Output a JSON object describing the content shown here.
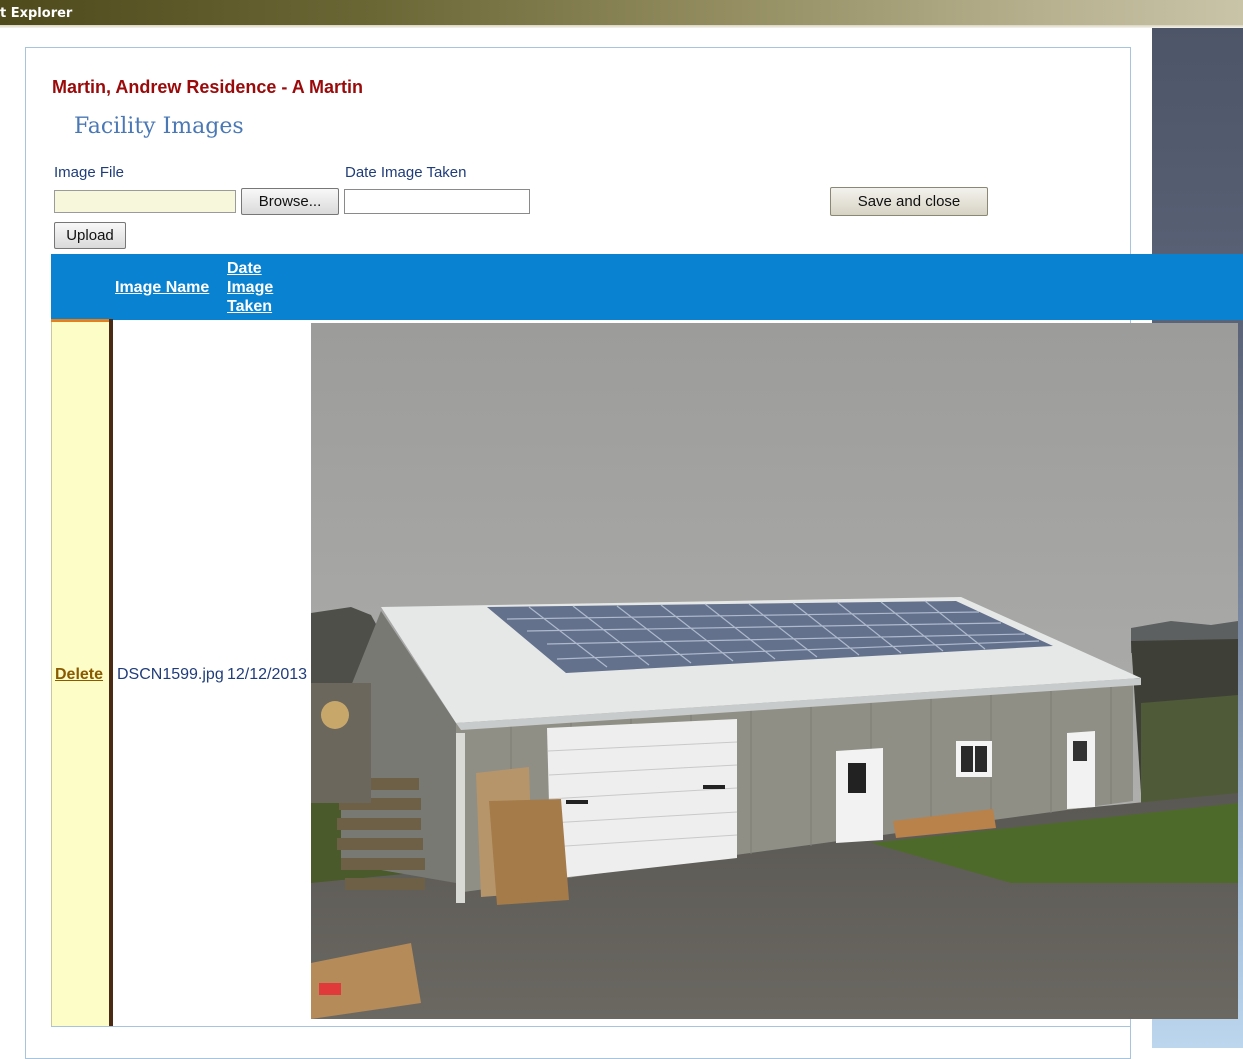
{
  "window": {
    "title": "t Explorer"
  },
  "facility": {
    "name": "Martin, Andrew Residence - A Martin"
  },
  "section": {
    "title": "Facility Images"
  },
  "form": {
    "image_file_label": "Image File",
    "date_taken_label": "Date Image Taken",
    "browse_label": "Browse...",
    "save_close_label": "Save and close",
    "upload_label": "Upload",
    "image_file_value": "",
    "date_taken_value": ""
  },
  "grid": {
    "columns": [
      "Image Name",
      "Date Image Taken"
    ],
    "rows": [
      {
        "action": "Delete",
        "image_name": "DSCN1599.jpg",
        "date_taken": "12/12/2013"
      }
    ]
  },
  "colors": {
    "header_blue": "#0a82d2",
    "facility_red": "#9b0a0a",
    "delete_cell_bg": "#fdfdc7"
  }
}
